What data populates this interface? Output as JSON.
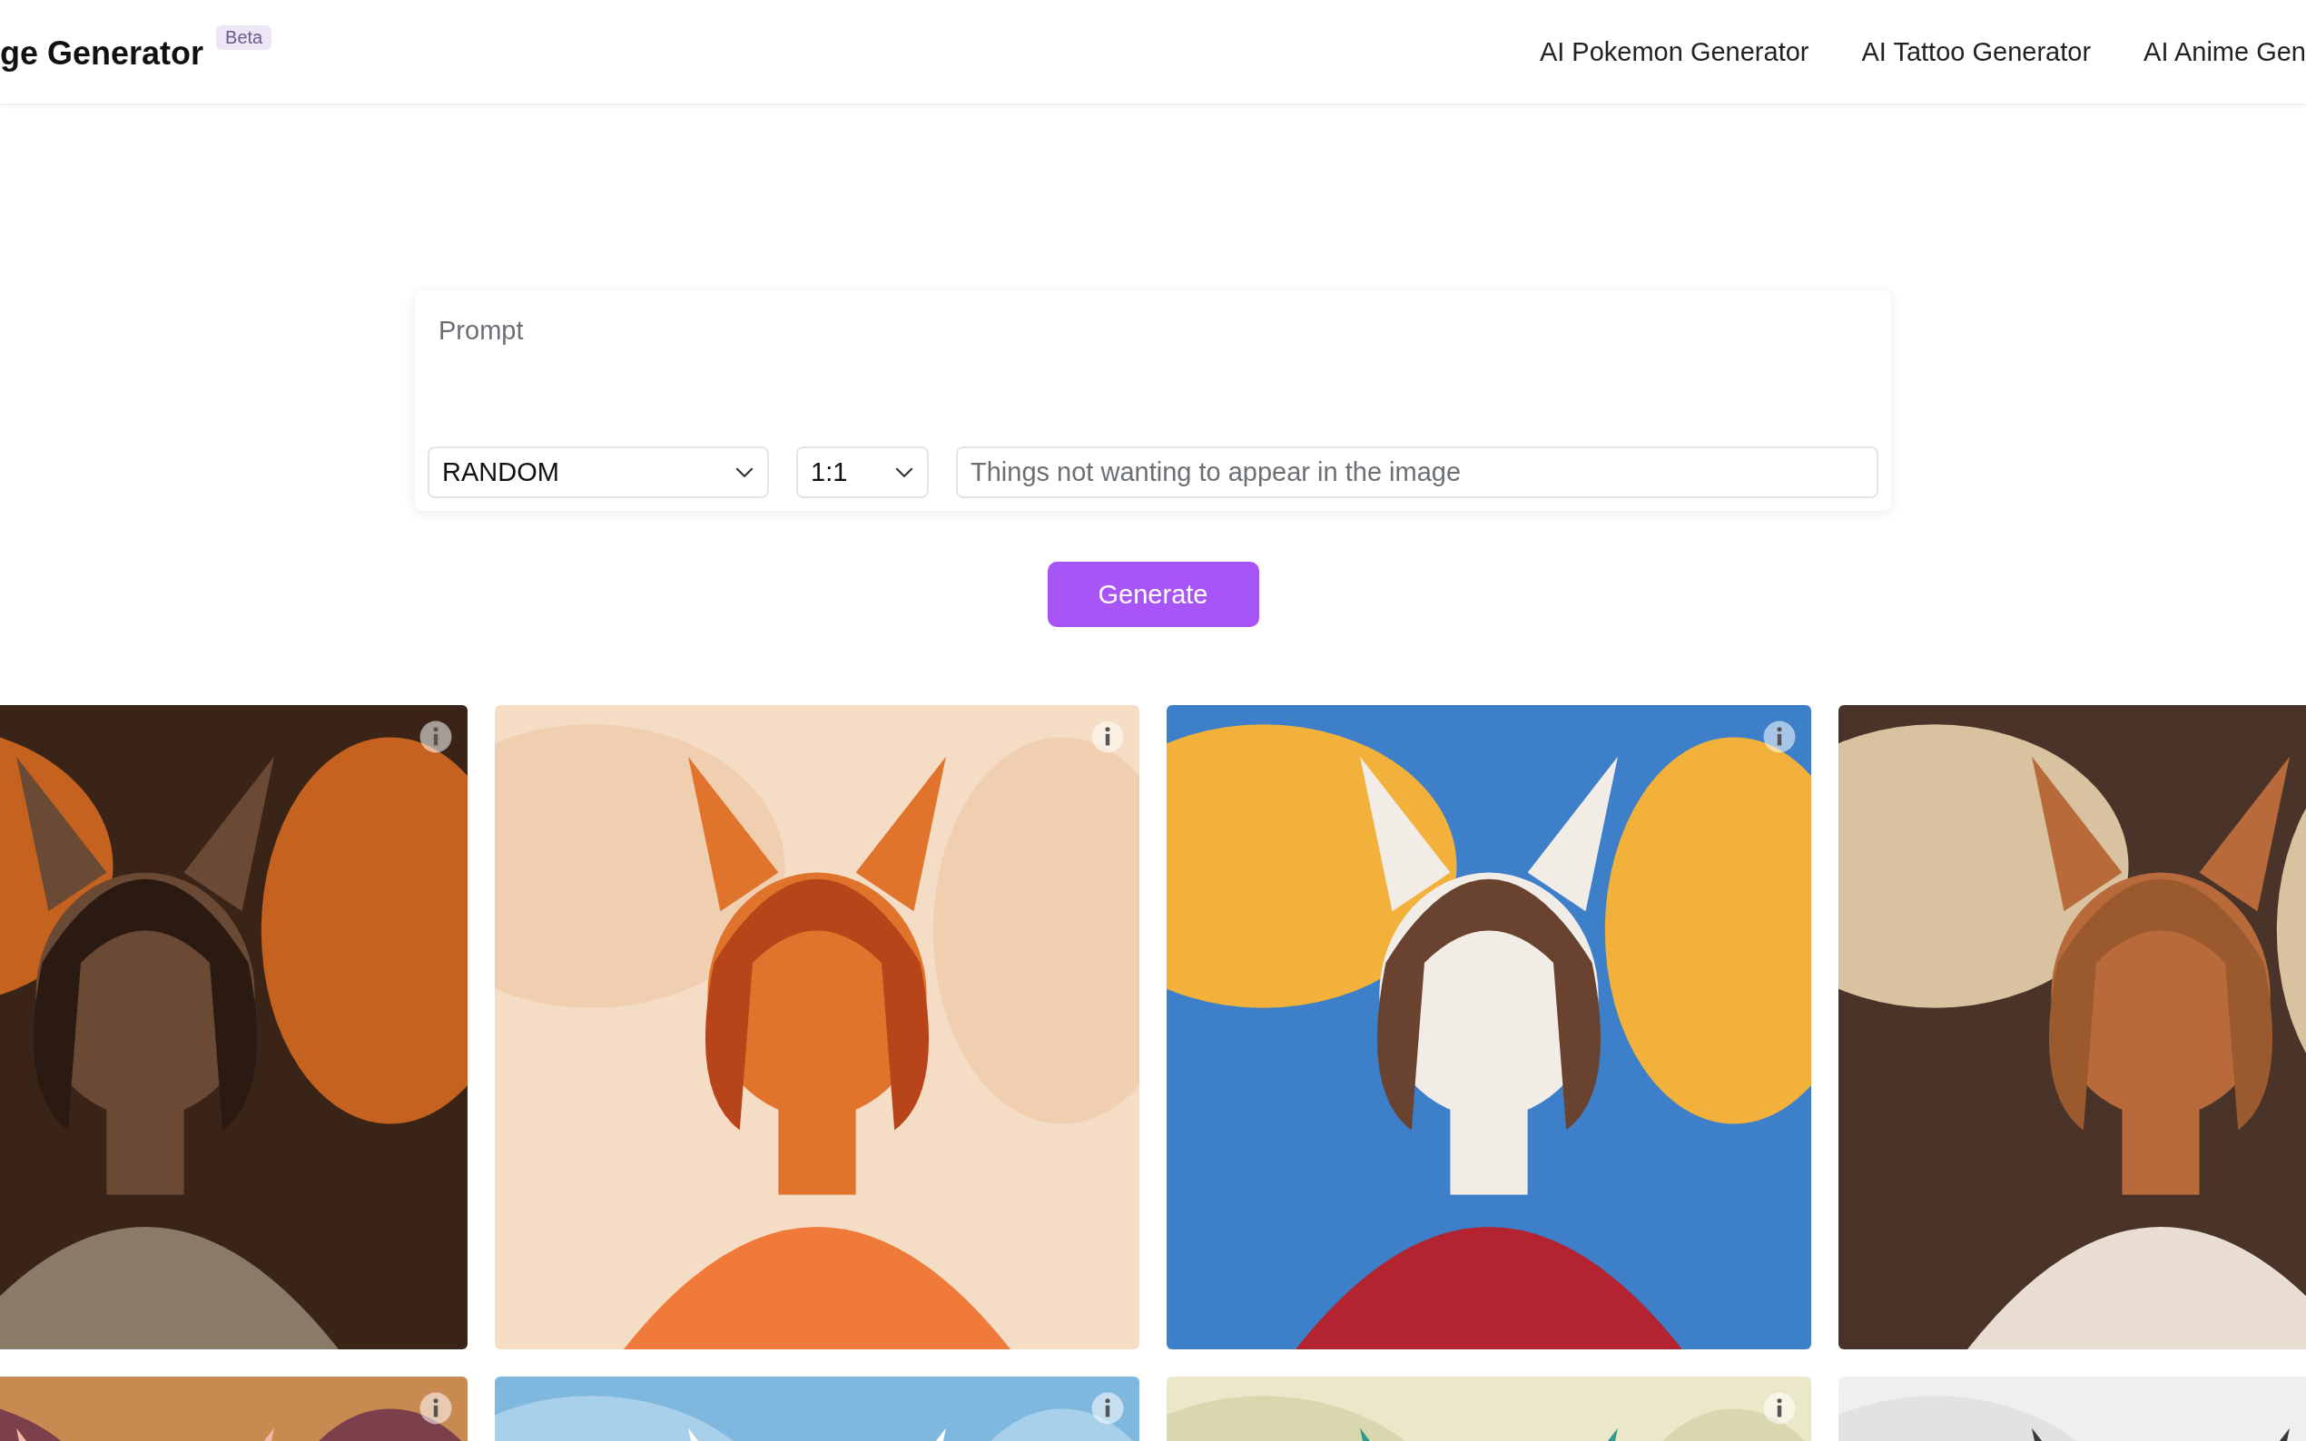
{
  "header": {
    "title": "ge Generator",
    "badge": "Beta",
    "nav": [
      "AI Pokemon Generator",
      "AI Tattoo Generator",
      "AI Anime Gen"
    ]
  },
  "form": {
    "prompt_placeholder": "Prompt",
    "style_select": "RANDOM",
    "ratio_select": "1:1",
    "negative_placeholder": "Things not wanting to appear in the image",
    "button": "Generate"
  },
  "gallery": [
    {
      "kind": "picture",
      "info": true
    },
    {
      "kind": "picture",
      "info": true
    },
    {
      "kind": "picture",
      "info": true
    },
    {
      "kind": "picture",
      "info": false
    },
    {
      "kind": "picture",
      "info": true
    },
    {
      "kind": "picture",
      "info": true
    },
    {
      "kind": "picture",
      "info": true
    },
    {
      "kind": "picture",
      "info": false
    }
  ]
}
